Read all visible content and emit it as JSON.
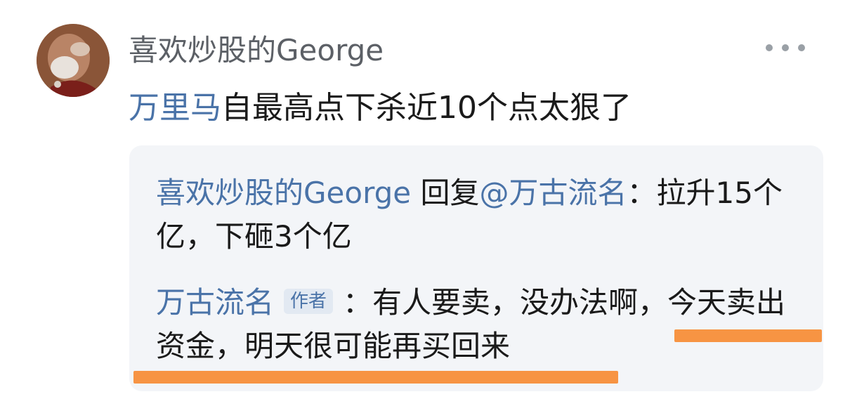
{
  "post": {
    "username": "喜欢炒股的George",
    "comment_mention": "万里马",
    "comment_rest": "自最高点下杀近10个点太狠了"
  },
  "replies": [
    {
      "author": "喜欢炒股的George",
      "action": " 回复",
      "target": "@万古流名",
      "text": "：拉升15个亿，下砸3个亿"
    },
    {
      "author": "万古流名",
      "badge": "作者",
      "text": "：有人要卖，没办法啊，今天卖出资金，明天很可能再买回来"
    }
  ],
  "colors": {
    "link": "#4a73a8",
    "highlight_underline": "#f79443",
    "reply_background": "#f3f5f8"
  },
  "icons": {
    "more": "more-horizontal-icon"
  }
}
